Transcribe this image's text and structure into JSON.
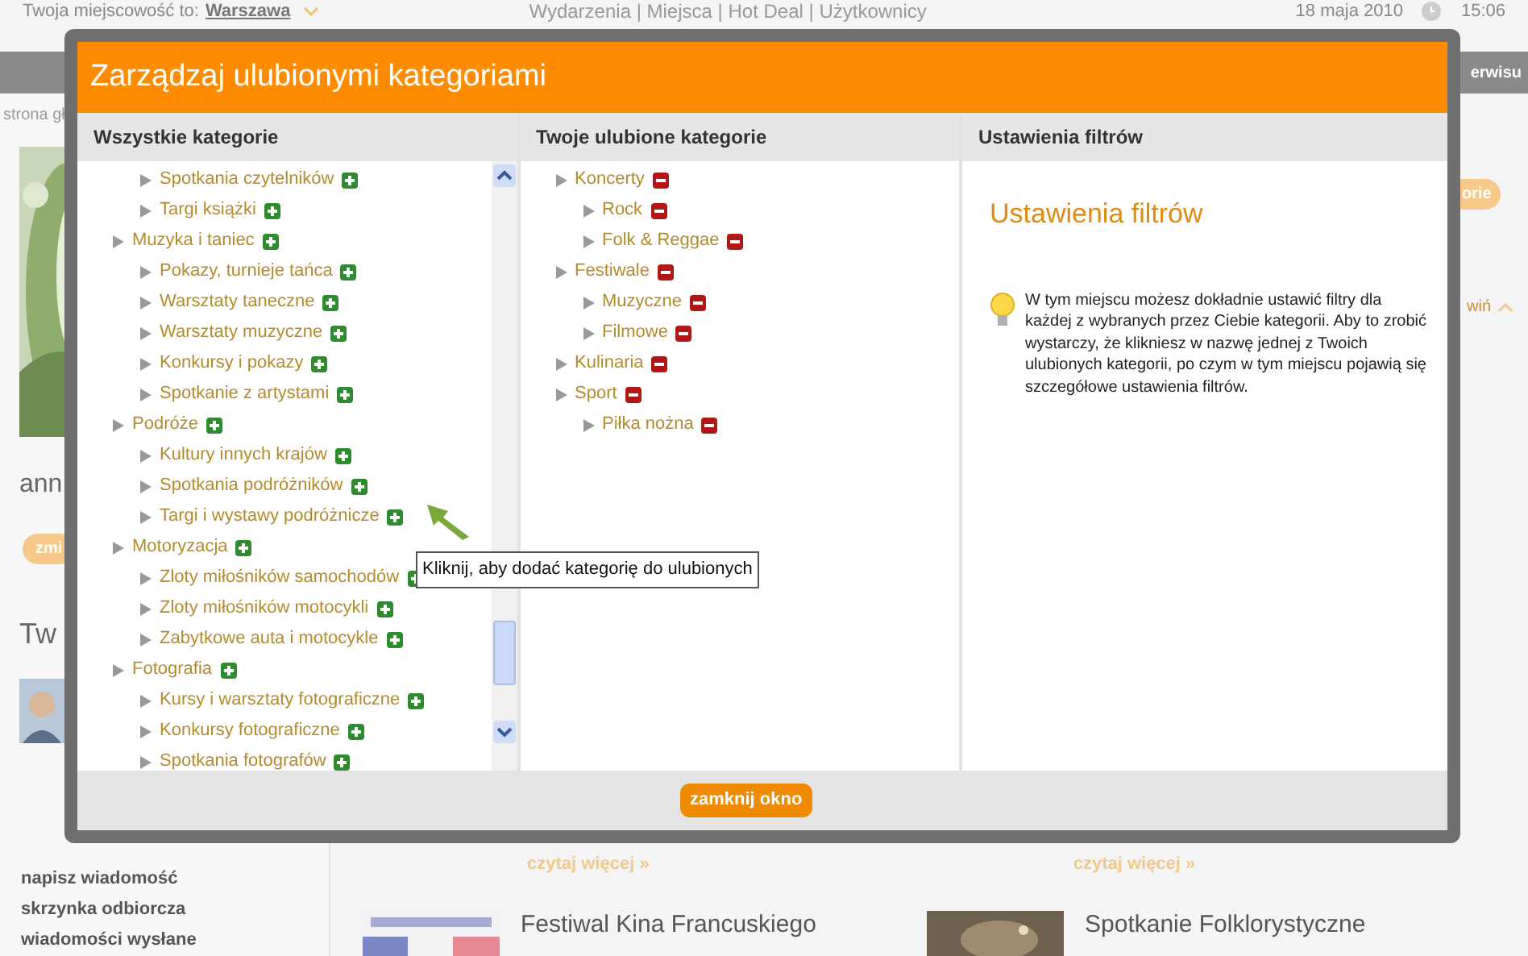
{
  "top_bar": {
    "location_label": "Twoja miejscowość to:",
    "location": "Warszawa",
    "nav": "Wydarzenia | Miejsca | Hot Deal | Użytkownicy",
    "date": "18 maja 2010",
    "time": "15:06"
  },
  "background": {
    "menu_bar_text": "erwisu",
    "breadcrumb": "strona gł",
    "user_name": "ann",
    "change_button": "zmi",
    "section_title": "Tw",
    "side_badge": "orie",
    "side_link": "wiń",
    "sidebar_links": [
      "napisz wiadomość",
      "skrzynka odbiorcza",
      "wiadomości wysłane"
    ],
    "read_more": [
      "czytaj więcej »",
      "czytaj więcej »"
    ],
    "events": [
      {
        "title": "Festiwal Kina Francuskiego",
        "kind": "picture"
      },
      {
        "title": "Spotkanie Folklorystyczne",
        "kind": "picture"
      }
    ]
  },
  "dialog": {
    "title": "Zarządzaj ulubionymi kategoriami",
    "columns": [
      {
        "heading": "Wszystkie kategorie",
        "tree": [
          {
            "children": [
              {
                "label": "Spotkania czytelników"
              },
              {
                "label": "Targi książki"
              }
            ]
          },
          {
            "label": "Muzyka i taniec",
            "children": [
              {
                "label": "Pokazy, turnieje tańca"
              },
              {
                "label": "Warsztaty taneczne"
              },
              {
                "label": "Warsztaty muzyczne"
              },
              {
                "label": "Konkursy i pokazy"
              },
              {
                "label": "Spotkanie z artystami"
              }
            ]
          },
          {
            "label": "Podróże",
            "children": [
              {
                "label": "Kultury innych krajów"
              },
              {
                "label": "Spotkania podróżników"
              },
              {
                "label": "Targi i wystawy podróżnicze"
              }
            ]
          },
          {
            "label": "Motoryzacja",
            "children": [
              {
                "label": "Zloty miłośników samochodów"
              },
              {
                "label": "Zloty miłośników motocykli"
              },
              {
                "label": "Zabytkowe auta i motocykle"
              }
            ]
          },
          {
            "label": "Fotografia",
            "children": [
              {
                "label": "Kursy i warsztaty fotograficzne"
              },
              {
                "label": "Konkursy fotograficzne"
              },
              {
                "label": "Spotkania fotografów"
              }
            ]
          }
        ]
      },
      {
        "heading": "Twoje ulubione kategorie",
        "tree": [
          {
            "label": "Koncerty",
            "children": [
              {
                "label": "Rock"
              },
              {
                "label": "Folk & Reggae"
              }
            ]
          },
          {
            "label": "Festiwale",
            "children": [
              {
                "label": "Muzyczne"
              },
              {
                "label": "Filmowe"
              }
            ]
          },
          {
            "label": "Kulinaria"
          },
          {
            "label": "Sport",
            "children": [
              {
                "label": "Piłka nożna"
              }
            ]
          }
        ]
      },
      {
        "heading": "Ustawienia filtrów",
        "title": "Ustawienia filtrów",
        "hint": "W tym miejscu możesz dokładnie ustawić filtry dla każdej z wybranych przez Ciebie kategorii. Aby to zrobić wystarczy, że klikniesz w nazwę jednej z Twoich ulubionych kategorii, po czym w tym miejscu pojawią się szczegółowe ustawienia filtrów."
      }
    ],
    "tooltip": "Kliknij, aby dodać kategorię do ulubionych",
    "close_button": "zamknij okno"
  }
}
